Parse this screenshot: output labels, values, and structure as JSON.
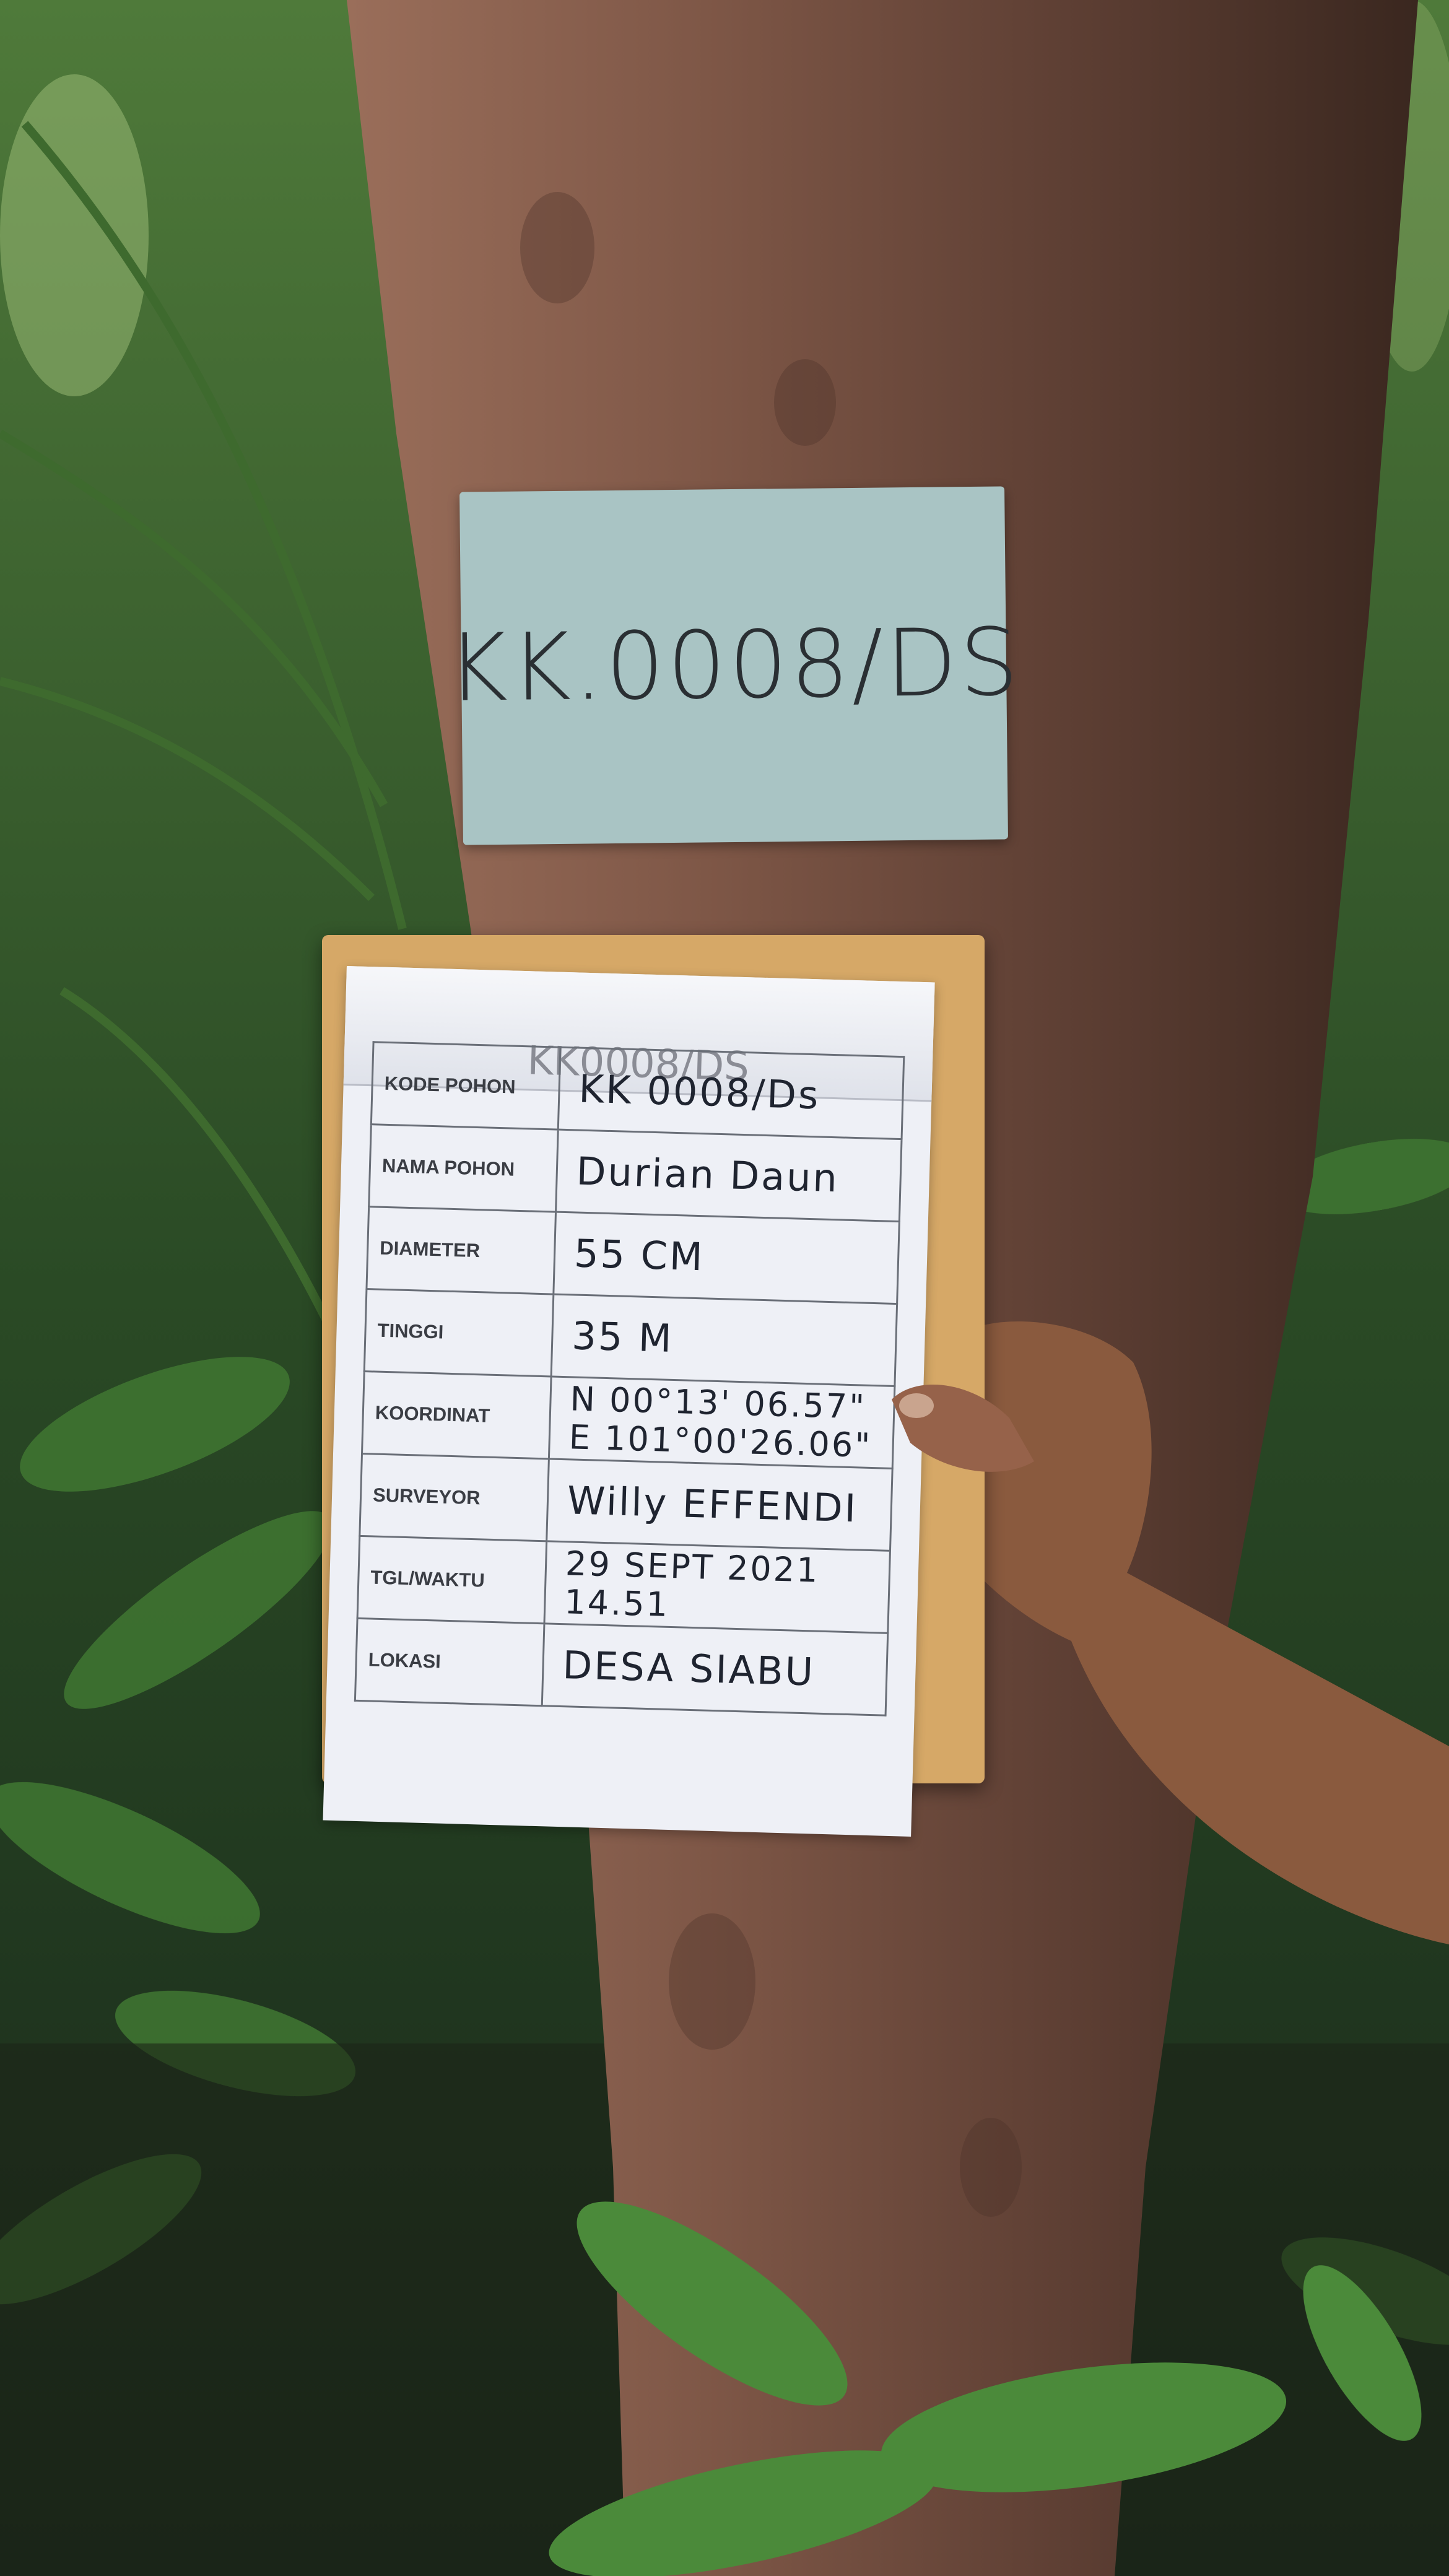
{
  "tree_tag": {
    "text": "KK.0008/DS"
  },
  "pad_header_faded": "KK0008/DS",
  "form": {
    "rows": [
      {
        "label": "KODE POHON",
        "value": "KK 0008/Ds"
      },
      {
        "label": "NAMA POHON",
        "value": "Durian Daun"
      },
      {
        "label": "DIAMETER",
        "value": "55 CM"
      },
      {
        "label": "TINGGI",
        "value": "35 M"
      },
      {
        "label": "KOORDINAT",
        "value": "N 00°13' 06.57\"",
        "value2": "E 101°00'26.06\""
      },
      {
        "label": "SURVEYOR",
        "value": "Willy EFFENDI"
      },
      {
        "label": "TGL/WAKTU",
        "value": "29 SEPT 2021",
        "value2": "14.51"
      },
      {
        "label": "LOKASI",
        "value": "DESA SIABU"
      }
    ]
  },
  "colors": {
    "bark": "#6b4a3a",
    "foliage": "#2f5a2a",
    "tag": "#a9c4c4",
    "clipboard": "#d6a867"
  }
}
